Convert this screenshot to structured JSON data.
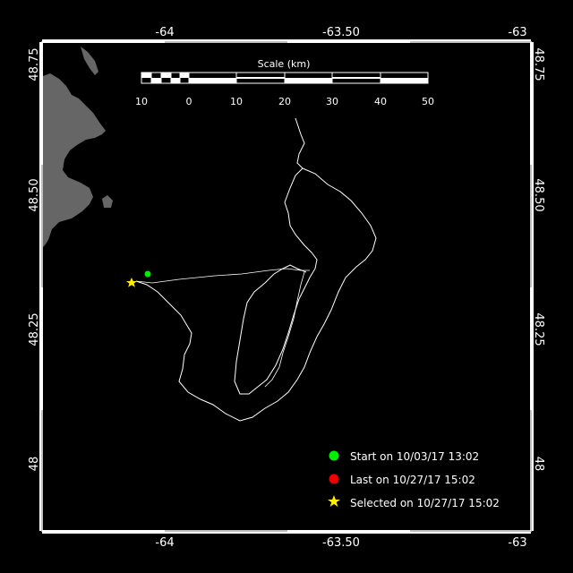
{
  "map": {
    "lon_labels": [
      "-64",
      "-63.50",
      "-63"
    ],
    "lat_labels": [
      "48.75",
      "48.50",
      "48.25",
      "48"
    ],
    "colors": {
      "background": "#000000",
      "land": "#666666",
      "track": "#ffffff",
      "start": "#00ee00",
      "last": "#ee0000",
      "selected": "#ffee00"
    }
  },
  "scale": {
    "title": "Scale (km)",
    "ticks": [
      "10",
      "0",
      "10",
      "20",
      "30",
      "40",
      "50"
    ]
  },
  "legend": {
    "start": "Start on 10/03/17 13:02",
    "last": "Last on 10/27/17 15:02",
    "selected": "Selected on 10/27/17 15:02"
  }
}
